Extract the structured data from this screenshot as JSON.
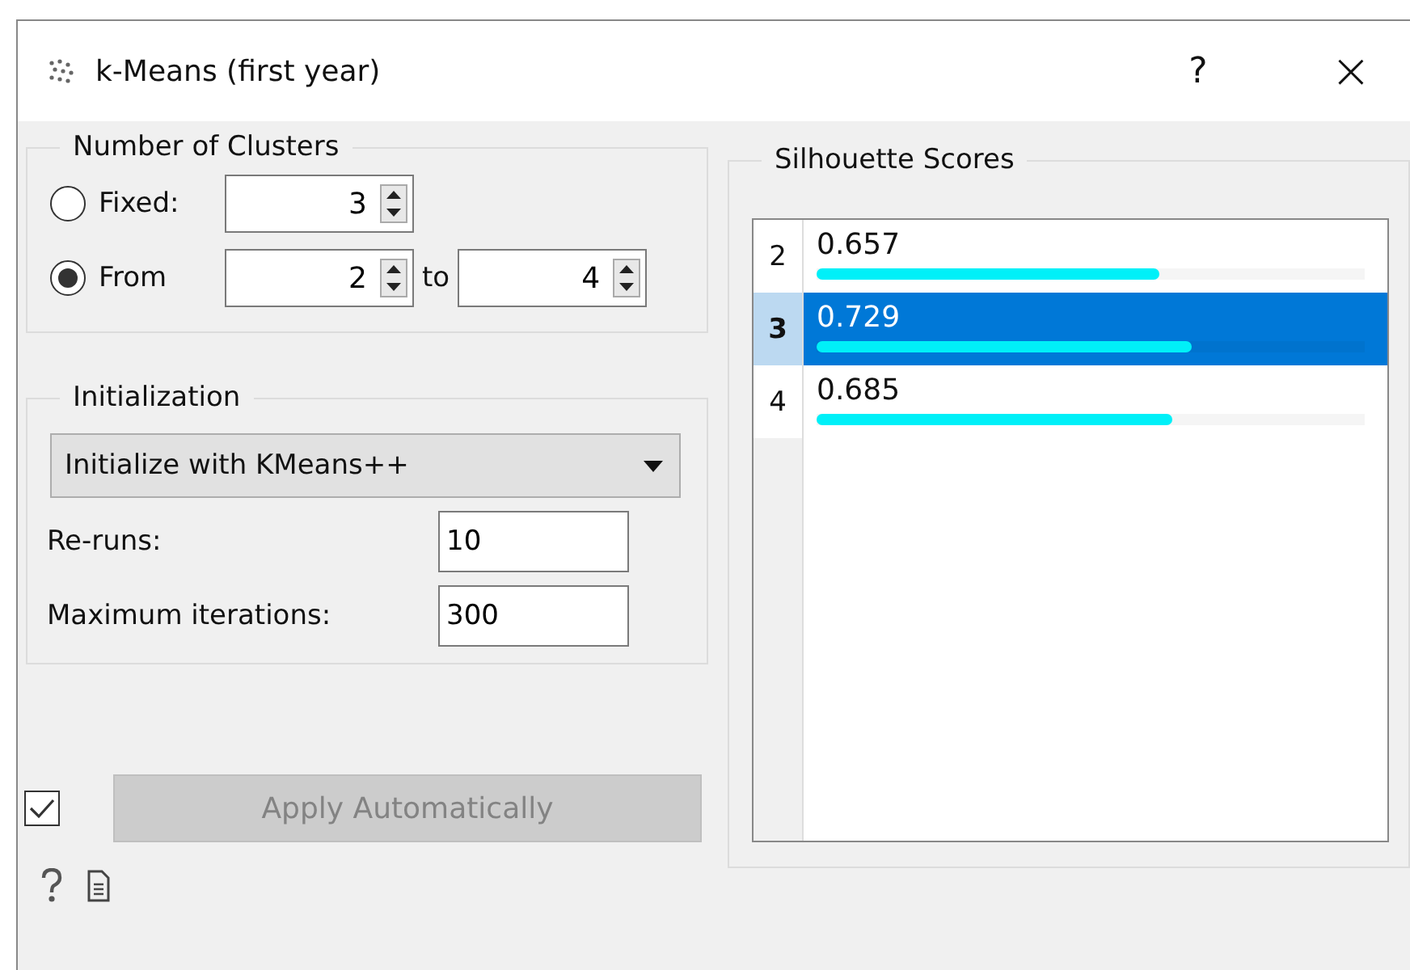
{
  "window": {
    "title": "k-Means (first year)",
    "help": "?",
    "close": "×"
  },
  "clusters": {
    "title": "Number of Clusters",
    "options": [
      {
        "label": "Fixed:",
        "selected": false,
        "values": [
          "3"
        ]
      },
      {
        "label": "From",
        "selected": true,
        "values": [
          "2",
          "4"
        ],
        "joiner": "to"
      }
    ]
  },
  "initialization": {
    "title": "Initialization",
    "method": "Initialize with KMeans++",
    "fields": [
      {
        "label": "Re-runs:",
        "value": "10"
      },
      {
        "label": "Maximum iterations:",
        "value": "300"
      }
    ]
  },
  "silhouette": {
    "title": "Silhouette Scores",
    "rows": [
      {
        "k": "2",
        "score": "0.657",
        "level": 0.625,
        "selected": false
      },
      {
        "k": "3",
        "score": "0.729",
        "level": 0.686,
        "selected": true
      },
      {
        "k": "4",
        "score": "0.685",
        "level": 0.65,
        "selected": false
      }
    ]
  },
  "auto_apply": {
    "checked": true,
    "disabled": true,
    "label": "Apply Automatically"
  }
}
